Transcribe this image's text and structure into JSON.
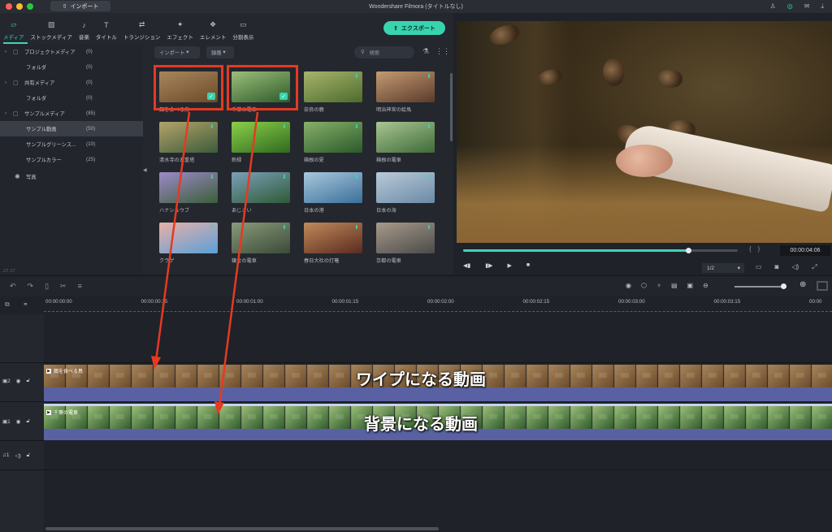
{
  "window": {
    "title": "Wondershare Filmora (タイトルなし)",
    "import_button": "インポート"
  },
  "toolbar": {
    "tabs": [
      {
        "label": "メディア",
        "icon": "folder-icon",
        "active": true
      },
      {
        "label": "ストックメディア",
        "icon": "stock-media-icon",
        "active": false
      },
      {
        "label": "音楽",
        "icon": "music-icon",
        "active": false
      },
      {
        "label": "タイトル",
        "icon": "title-icon",
        "active": false
      },
      {
        "label": "トランジション",
        "icon": "transition-icon",
        "active": false
      },
      {
        "label": "エフェクト",
        "icon": "effect-icon",
        "active": false
      },
      {
        "label": "エレメント",
        "icon": "element-icon",
        "active": false
      },
      {
        "label": "分割表示",
        "icon": "split-screen-icon",
        "active": false
      }
    ],
    "export_label": "エクスポート"
  },
  "media_tree": [
    {
      "label": "プロジェクトメディア",
      "count": "(0)",
      "level": 0,
      "expandable": true
    },
    {
      "label": "フォルダ",
      "count": "(0)",
      "level": 1,
      "expandable": false
    },
    {
      "label": "共有メディア",
      "count": "(0)",
      "level": 0,
      "expandable": true
    },
    {
      "label": "フォルダ",
      "count": "(0)",
      "level": 1,
      "expandable": false
    },
    {
      "label": "サンプルメディア",
      "count": "(85)",
      "level": 0,
      "expandable": true
    },
    {
      "label": "サンプル動画",
      "count": "(50)",
      "level": 1,
      "expandable": false,
      "selected": true
    },
    {
      "label": "サンプルグリーンス...",
      "count": "(10)",
      "level": 1,
      "expandable": false
    },
    {
      "label": "サンプルカラー",
      "count": "(25)",
      "level": 1,
      "expandable": false
    },
    {
      "label": "写真",
      "count": "",
      "level": 0,
      "expandable": false
    }
  ],
  "filter": {
    "import_dropdown": "インポート",
    "record_dropdown": "録画",
    "search_placeholder": "検索"
  },
  "media_items": [
    {
      "caption": "餌を食べる鳥",
      "colors": [
        "#6b4a2a",
        "#a8865c"
      ],
      "added": true
    },
    {
      "caption": "千葉の電車",
      "colors": [
        "#2e5a2a",
        "#9cbf7a"
      ],
      "added": true
    },
    {
      "caption": "奈良の鹿",
      "colors": [
        "#4d6b2c",
        "#a7b46c"
      ],
      "added": false
    },
    {
      "caption": "明治神宮の絵馬",
      "colors": [
        "#5a3a2a",
        "#c49a72"
      ],
      "added": false
    },
    {
      "caption": "清水寺の五重塔",
      "colors": [
        "#3d5b3a",
        "#b3a36a"
      ],
      "added": false
    },
    {
      "caption": "新緑",
      "colors": [
        "#2f6a1e",
        "#8bcf4a"
      ],
      "added": false
    },
    {
      "caption": "箱根の夏",
      "colors": [
        "#2a5a2a",
        "#88b06a"
      ],
      "added": false
    },
    {
      "caption": "箱根の電車",
      "colors": [
        "#3e6a3a",
        "#a9c690"
      ],
      "added": false
    },
    {
      "caption": "ハナショウブ",
      "colors": [
        "#3c5e3a",
        "#9c8bc8"
      ],
      "added": false
    },
    {
      "caption": "あじさい",
      "colors": [
        "#2e5a36",
        "#7aa0b8"
      ],
      "added": false
    },
    {
      "caption": "日本の港",
      "colors": [
        "#3a6f9a",
        "#a9c8dc"
      ],
      "added": false
    },
    {
      "caption": "日本の海",
      "colors": [
        "#6a8aa6",
        "#b9cad8"
      ],
      "added": false
    },
    {
      "caption": "クラゲ",
      "colors": [
        "#5aa0d8",
        "#e8b0a8"
      ],
      "added": false
    },
    {
      "caption": "鎌倉の電車",
      "colors": [
        "#3a4a38",
        "#8a9a7a"
      ],
      "added": false
    },
    {
      "caption": "春日大社の灯篭",
      "colors": [
        "#5a2a20",
        "#c08a5a"
      ],
      "added": false
    },
    {
      "caption": "京都の電車",
      "colors": [
        "#4a4a4a",
        "#a89a8a"
      ],
      "added": false
    }
  ],
  "preview": {
    "timecode": "00:00:04:06",
    "progress": 0.82,
    "zoom": "1/2"
  },
  "timeline": {
    "ruler_ticks": [
      "00:00:00:00",
      "00:00:00:15",
      "00:00:01:00",
      "00:00:01:15",
      "00:00:02:00",
      "00:00:02:15",
      "00:00:03:00",
      "00:00:03:15",
      "00:00"
    ],
    "zoom_level": 0.94,
    "tracks": [
      {
        "id": "2",
        "type": "video",
        "clip_name": "餌を食べる鳥",
        "overlay": "ワイプになる動画"
      },
      {
        "id": "1",
        "type": "video",
        "clip_name": "千葉の電車",
        "overlay": "背景になる動画"
      },
      {
        "id": "1",
        "type": "audio",
        "clip_name": "",
        "overlay": ""
      }
    ]
  },
  "annotation_color": "#e53a22",
  "accent_color": "#3fd4b6"
}
